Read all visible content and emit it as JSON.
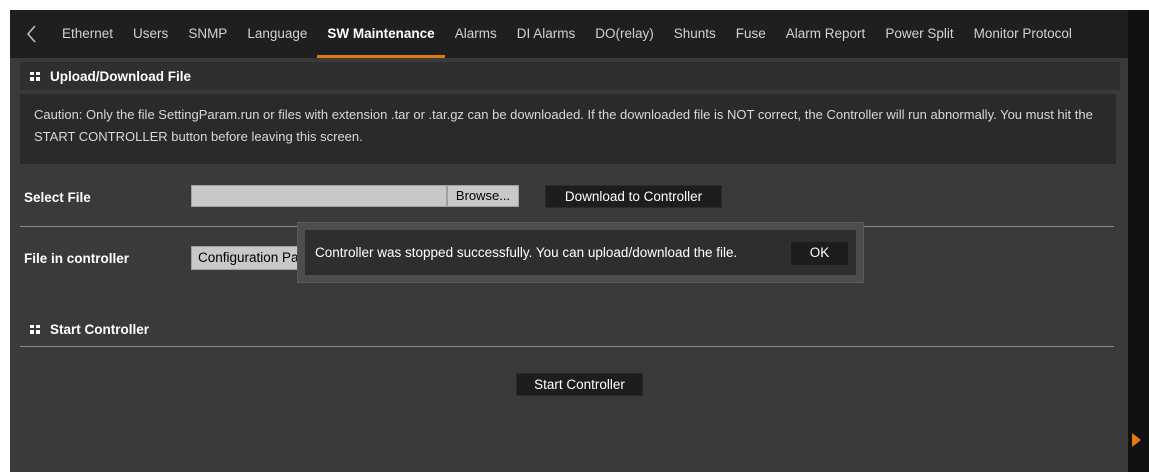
{
  "tabs": [
    {
      "label": "Ethernet",
      "active": false
    },
    {
      "label": "Users",
      "active": false
    },
    {
      "label": "SNMP",
      "active": false
    },
    {
      "label": "Language",
      "active": false
    },
    {
      "label": "SW Maintenance",
      "active": true
    },
    {
      "label": "Alarms",
      "active": false
    },
    {
      "label": "DI Alarms",
      "active": false
    },
    {
      "label": "DO(relay)",
      "active": false
    },
    {
      "label": "Shunts",
      "active": false
    },
    {
      "label": "Fuse",
      "active": false
    },
    {
      "label": "Alarm Report",
      "active": false
    },
    {
      "label": "Power Split",
      "active": false
    },
    {
      "label": "Monitor Protocol",
      "active": false
    }
  ],
  "upload_section": {
    "title": "Upload/Download File",
    "caution": "Caution: Only the file SettingParam.run or files with extension .tar or .tar.gz can be downloaded. If the downloaded file is NOT correct, the Controller will run abnormally. You must hit the START CONTROLLER button before leaving this screen.",
    "select_file_label": "Select File",
    "file_value": "",
    "browse_label": "Browse...",
    "download_label": "Download to Controller",
    "file_in_controller_label": "File in controller",
    "file_in_controller_value": "Configuration Package"
  },
  "start_section": {
    "title": "Start Controller",
    "start_label": "Start Controller"
  },
  "modal": {
    "message": "Controller was stopped successfully. You can upload/download the file.",
    "ok_label": "OK"
  },
  "colors": {
    "accent": "#e07b14",
    "panel_bg": "#3a3a3a",
    "tabbar_bg": "#1f1f1f"
  },
  "icons": {
    "back": "chevron-left-icon",
    "section": "grid-icon",
    "side_scroll": "triangle-right-icon"
  }
}
